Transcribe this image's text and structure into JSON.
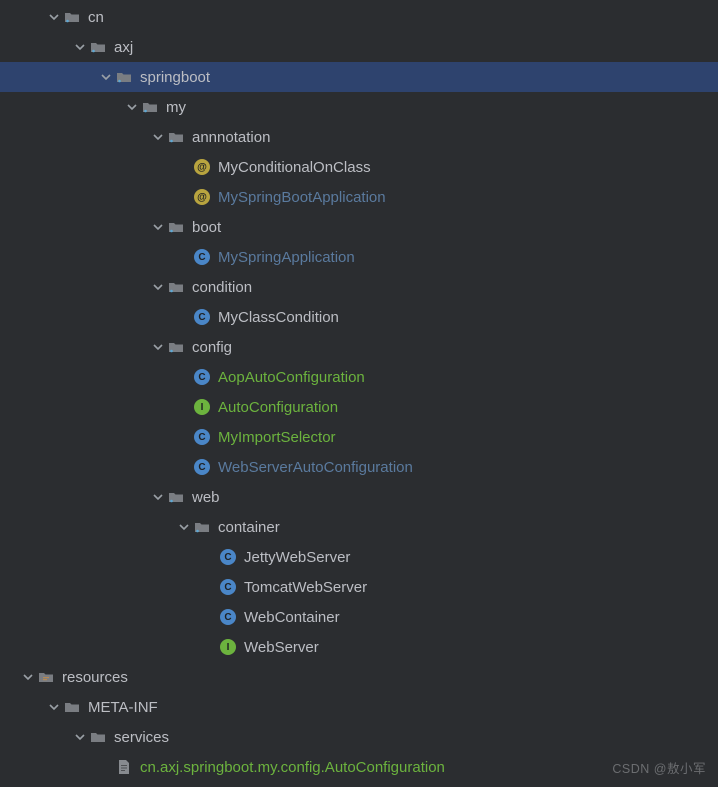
{
  "watermark": "CSDN @敖小军",
  "rows": [
    {
      "depth": 0,
      "expanded": true,
      "kind": "pkg",
      "text": "cn"
    },
    {
      "depth": 1,
      "expanded": true,
      "kind": "pkg",
      "text": "axj"
    },
    {
      "depth": 2,
      "expanded": true,
      "kind": "pkg",
      "text": "springboot",
      "selected": true
    },
    {
      "depth": 3,
      "expanded": true,
      "kind": "pkg",
      "text": "my"
    },
    {
      "depth": 4,
      "expanded": true,
      "kind": "pkg",
      "text": "annnotation"
    },
    {
      "depth": 5,
      "expanded": null,
      "kind": "anno",
      "text": "MyConditionalOnClass"
    },
    {
      "depth": 5,
      "expanded": null,
      "kind": "anno",
      "text": "MySpringBootApplication",
      "style": "unused"
    },
    {
      "depth": 4,
      "expanded": true,
      "kind": "pkg",
      "text": "boot"
    },
    {
      "depth": 5,
      "expanded": null,
      "kind": "class",
      "text": "MySpringApplication",
      "style": "unused"
    },
    {
      "depth": 4,
      "expanded": true,
      "kind": "pkg",
      "text": "condition"
    },
    {
      "depth": 5,
      "expanded": null,
      "kind": "class",
      "text": "MyClassCondition"
    },
    {
      "depth": 4,
      "expanded": true,
      "kind": "pkg",
      "text": "config"
    },
    {
      "depth": 5,
      "expanded": null,
      "kind": "class",
      "text": "AopAutoConfiguration",
      "style": "green"
    },
    {
      "depth": 5,
      "expanded": null,
      "kind": "interface",
      "text": "AutoConfiguration",
      "style": "green"
    },
    {
      "depth": 5,
      "expanded": null,
      "kind": "class",
      "text": "MyImportSelector",
      "style": "green"
    },
    {
      "depth": 5,
      "expanded": null,
      "kind": "class",
      "text": "WebServerAutoConfiguration",
      "style": "unused"
    },
    {
      "depth": 4,
      "expanded": true,
      "kind": "pkg",
      "text": "web"
    },
    {
      "depth": 5,
      "expanded": true,
      "kind": "pkg",
      "text": "container"
    },
    {
      "depth": 6,
      "expanded": null,
      "kind": "class",
      "text": "JettyWebServer"
    },
    {
      "depth": 6,
      "expanded": null,
      "kind": "class",
      "text": "TomcatWebServer"
    },
    {
      "depth": 6,
      "expanded": null,
      "kind": "class",
      "text": "WebContainer"
    },
    {
      "depth": 6,
      "expanded": null,
      "kind": "interface",
      "text": "WebServer"
    },
    {
      "depth": -1,
      "expanded": true,
      "kind": "res",
      "text": "resources"
    },
    {
      "depth": 0,
      "expanded": true,
      "kind": "folder",
      "text": "META-INF"
    },
    {
      "depth": 1,
      "expanded": true,
      "kind": "folder",
      "text": "services"
    },
    {
      "depth": 2,
      "expanded": null,
      "kind": "file",
      "text": "cn.axj.springboot.my.config.AutoConfiguration",
      "style": "green"
    }
  ],
  "indentBase": 20,
  "indentStep": 26
}
